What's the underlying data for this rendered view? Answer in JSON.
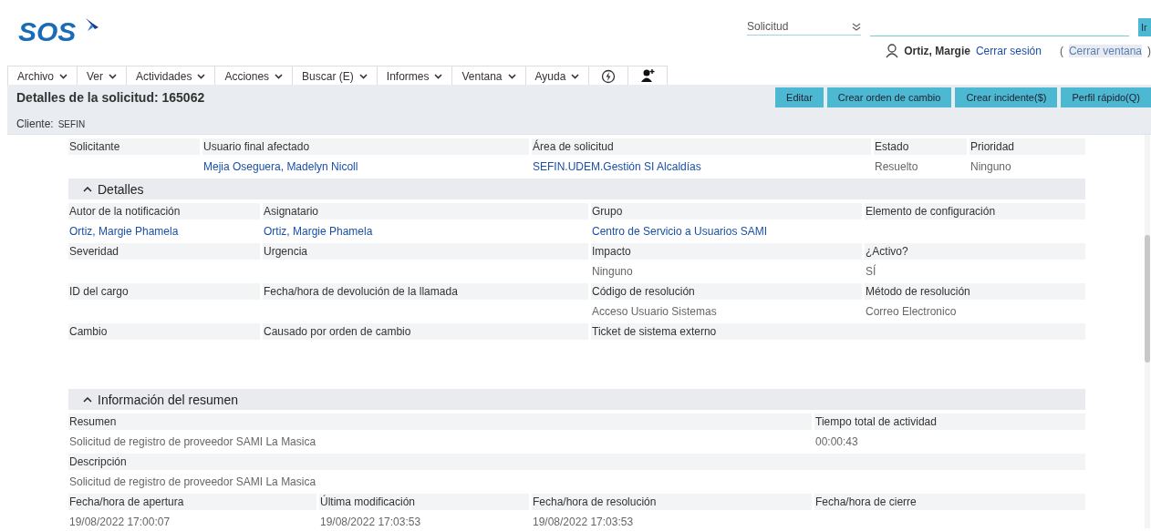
{
  "logo": {
    "text": "SOS"
  },
  "search": {
    "type_value": "Solicitud",
    "button": "Ir"
  },
  "user": {
    "name": "Ortiz, Margie",
    "logout": "Cerrar sesión",
    "close_window": {
      "open": "(",
      "text": "Cerrar ventana",
      "close": ")"
    }
  },
  "menu": [
    {
      "label": "Archivo"
    },
    {
      "label": "Ver"
    },
    {
      "label": "Actividades"
    },
    {
      "label": "Acciones"
    },
    {
      "label": "Buscar (E)"
    },
    {
      "label": "Informes"
    },
    {
      "label": "Ventana"
    },
    {
      "label": "Ayuda"
    }
  ],
  "page": {
    "title": "Detalles de la solicitud: 165062",
    "client_label": "Cliente:",
    "client_value": "SEFIN"
  },
  "actions": [
    "Editar",
    "Crear orden de cambio",
    "Crear incidente($)",
    "Perfil rápido(Q)"
  ],
  "header_fields": [
    {
      "label": "Solicitante",
      "kind": "text"
    },
    {
      "label": "Usuario final afectado",
      "value": "Mejia Oseguera, Madelyn Nicoll",
      "kind": "link"
    },
    {
      "label": "Área de solicitud",
      "value": "SEFIN.UDEM.Gestión SI Alcaldías",
      "kind": "link"
    },
    {
      "label": "Estado",
      "value": "Resuelto",
      "kind": "text"
    },
    {
      "label": "Prioridad",
      "value": "Ninguno",
      "kind": "text"
    }
  ],
  "sections": [
    {
      "title": "Detalles",
      "expanded": true,
      "rows": [
        [
          {
            "label": "Autor de la notificación",
            "value": "Ortiz, Margie Phamela",
            "kind": "link"
          },
          {
            "label": "Asignatario",
            "value": "Ortiz, Margie Phamela",
            "kind": "link"
          },
          {
            "label": "Grupo",
            "value": "Centro de Servicio a Usuarios SAMI",
            "kind": "link"
          },
          {
            "label": "Elemento de configuración",
            "kind": "text"
          }
        ],
        [
          {
            "label": "Severidad",
            "kind": "text"
          },
          {
            "label": "Urgencia",
            "kind": "text"
          },
          {
            "label": "Impacto",
            "value": "Ninguno",
            "kind": "text"
          },
          {
            "label": "¿Activo?",
            "value": "SÍ",
            "kind": "text"
          }
        ],
        [
          {
            "label": "ID del cargo",
            "kind": "text"
          },
          {
            "label": "Fecha/hora de devolución de la llamada",
            "kind": "text"
          },
          {
            "label": "Código de resolución",
            "value": "Acceso Usuario Sistemas",
            "kind": "text"
          },
          {
            "label": "Método de resolución",
            "value": "Correo Electronico",
            "kind": "text"
          }
        ],
        [
          {
            "label": "Cambio",
            "kind": "text"
          },
          {
            "label": "Causado por orden de cambio",
            "kind": "text"
          },
          {
            "label": "Ticket de sistema externo",
            "kind": "text"
          },
          {}
        ]
      ]
    },
    {
      "title": "Información del resumen",
      "expanded": true,
      "rows": [
        [
          {
            "label": "Resumen",
            "value": "Solicitud de registro de proveedor SAMI La Masica",
            "kind": "text"
          },
          {},
          {},
          {
            "label": "Tiempo total de actividad",
            "value": "00:00:43",
            "kind": "text"
          }
        ],
        [
          {
            "label": "Descripción",
            "value": "Solicitud de registro de proveedor SAMI La Masica",
            "kind": "text"
          },
          {},
          {},
          {}
        ],
        [
          {
            "label": "Fecha/hora de apertura",
            "value": "19/08/2022 17:00:07",
            "kind": "text"
          },
          {
            "label": "Última modificación",
            "value": "19/08/2022 17:03:53",
            "kind": "text"
          },
          {
            "label": "Fecha/hora de resolución",
            "value": "19/08/2022 17:03:53",
            "kind": "text"
          },
          {
            "label": "Fecha/hora de cierre",
            "kind": "text"
          }
        ]
      ]
    }
  ]
}
